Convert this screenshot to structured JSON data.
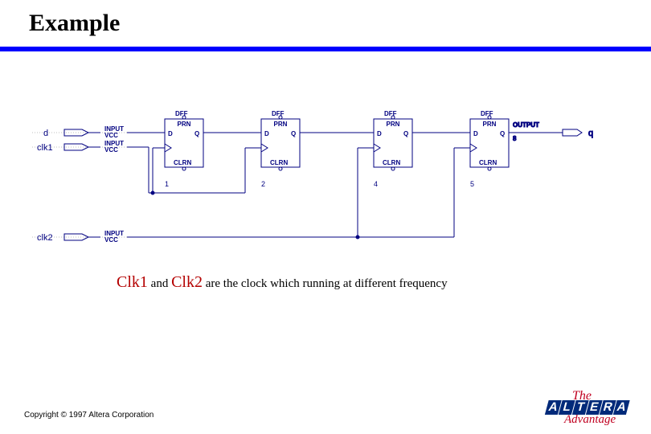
{
  "title": "Example",
  "signals": {
    "d": "d",
    "clk1": "clk1",
    "clk2": "clk2",
    "input": "INPUT",
    "vcc": "VCC",
    "output": "OUTPUT",
    "q_wire": "8",
    "q_out": "q"
  },
  "flop": {
    "type": "DFF",
    "prn": "PRN",
    "d": "D",
    "q": "Q",
    "clrn": "CLRN"
  },
  "flop_ids": [
    "1",
    "2",
    "4",
    "5"
  ],
  "caption": {
    "c1": "Clk1",
    "and": " and ",
    "c2": "Clk2",
    "rest": " are the clock which running at different frequency"
  },
  "copyright": "Copyright © 1997 Altera Corporation",
  "logo": {
    "the": "The",
    "letters": [
      "A",
      "L",
      "T",
      "E",
      "R",
      "A"
    ],
    "sub": "Advantage"
  },
  "chart_data": {
    "type": "schematic",
    "inputs": [
      {
        "name": "d",
        "type": "INPUT",
        "tied": "VCC"
      },
      {
        "name": "clk1",
        "type": "INPUT",
        "tied": "VCC"
      },
      {
        "name": "clk2",
        "type": "INPUT",
        "tied": "VCC"
      }
    ],
    "outputs": [
      {
        "name": "q",
        "type": "OUTPUT",
        "net": "8"
      }
    ],
    "components": [
      {
        "id": "1",
        "type": "DFF",
        "clk": "clk1",
        "d": "d",
        "q": "net1"
      },
      {
        "id": "2",
        "type": "DFF",
        "clk": "clk1",
        "d": "net1",
        "q": "net2"
      },
      {
        "id": "4",
        "type": "DFF",
        "clk": "clk2",
        "d": "net2",
        "q": "net4"
      },
      {
        "id": "5",
        "type": "DFF",
        "clk": "clk2",
        "d": "net4",
        "q": "q"
      }
    ],
    "notes": "Four DFFs in series; first two clocked by clk1, last two by clk2."
  }
}
